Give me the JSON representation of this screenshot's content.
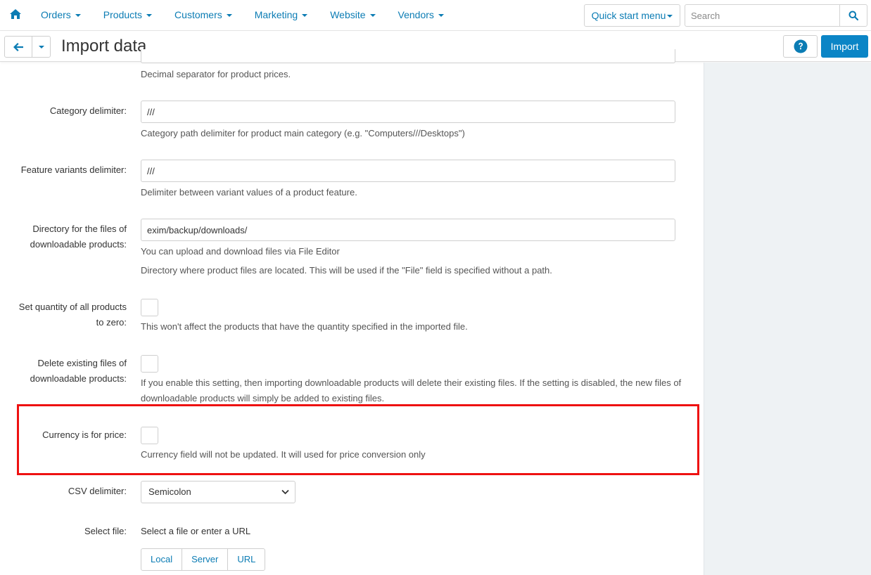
{
  "nav": {
    "home_icon": "home-icon",
    "items": [
      {
        "label": "Orders"
      },
      {
        "label": "Products"
      },
      {
        "label": "Customers"
      },
      {
        "label": "Marketing"
      },
      {
        "label": "Website"
      },
      {
        "label": "Vendors"
      }
    ],
    "quick_start_label": "Quick start menu",
    "search_placeholder": "Search",
    "search_icon": "search-icon",
    "accent_color": "#0b7cb4"
  },
  "header": {
    "title": "Import data",
    "back_icon": "arrow-left-icon",
    "help_icon": "question-circle-icon",
    "import_label": "Import",
    "import_color": "#0b85c6"
  },
  "form": {
    "decimal_separator_hint": "Decimal separator for product prices.",
    "category_delimiter": {
      "label": "Category delimiter:",
      "value": "///",
      "hint": "Category path delimiter for product main category (e.g. \"Computers///Desktops\")"
    },
    "feature_variants_delimiter": {
      "label": "Feature variants delimiter:",
      "value": "///",
      "hint": "Delimiter between variant values of a product feature."
    },
    "files_directory": {
      "label_line1": "Directory for the files of",
      "label_line2": "downloadable products:",
      "value": "exim/backup/downloads/",
      "hint1": "You can upload and download files via File Editor",
      "hint2": "Directory where product files are located. This will be used if the \"File\" field is specified without a path."
    },
    "set_quantity_zero": {
      "label_line1": "Set quantity of all products",
      "label_line2": "to zero:",
      "checked": false,
      "hint": "This won't affect the products that have the quantity specified in the imported file."
    },
    "delete_existing_files": {
      "label_line1": "Delete existing files of",
      "label_line2": "downloadable products:",
      "checked": false,
      "hint": "If you enable this setting, then importing downloadable products will delete their existing files. If the setting is disabled, the new files of downloadable products will simply be added to existing files."
    },
    "currency_for_price": {
      "label": "Currency is for price:",
      "checked": false,
      "hint": "Currency field will not be updated. It will used for price conversion only",
      "highlight_color": "#ee1111"
    },
    "csv_delimiter": {
      "label": "CSV delimiter:",
      "selected": "Semicolon"
    },
    "select_file": {
      "label": "Select file:",
      "text": "Select a file or enter a URL",
      "buttons": [
        "Local",
        "Server",
        "URL"
      ]
    }
  }
}
